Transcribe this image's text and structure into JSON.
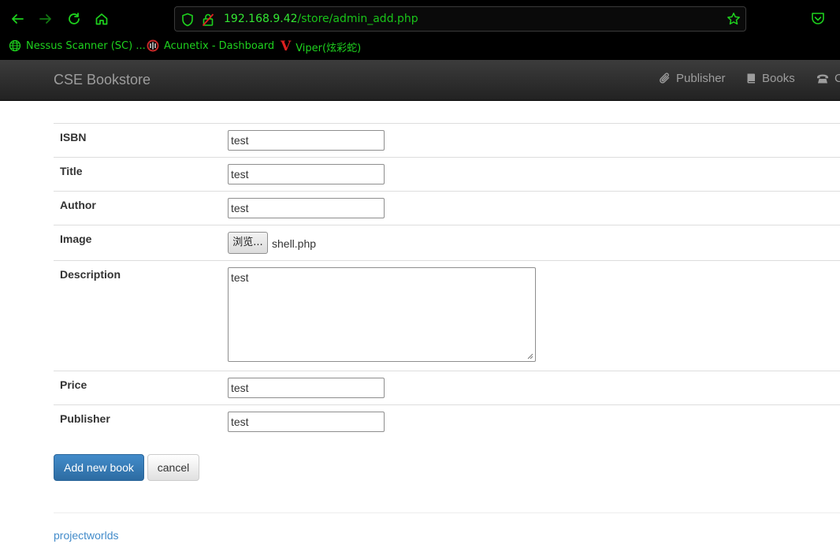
{
  "browser": {
    "url_host": "192.168.9.42",
    "url_path": "/store/admin_add.php",
    "bookmarks": [
      {
        "label": "Nessus Scanner (SC) ..."
      },
      {
        "label": "Acunetix - Dashboard"
      },
      {
        "label": "Viper(炫彩蛇)"
      }
    ],
    "accent_color": "#1ed21e"
  },
  "navbar": {
    "brand": "CSE Bookstore",
    "links": [
      {
        "label": "Publisher",
        "icon": "paperclip-icon"
      },
      {
        "label": "Books",
        "icon": "book-icon"
      },
      {
        "label": "C",
        "icon": "phone-icon"
      }
    ]
  },
  "form": {
    "isbn": {
      "label": "ISBN",
      "value": "test"
    },
    "title": {
      "label": "Title",
      "value": "test"
    },
    "author": {
      "label": "Author",
      "value": "test"
    },
    "image": {
      "label": "Image",
      "button": "浏览...",
      "filename": "shell.php"
    },
    "description": {
      "label": "Description",
      "value": "test"
    },
    "price": {
      "label": "Price",
      "value": "test"
    },
    "publisher": {
      "label": "Publisher",
      "value": "test"
    },
    "submit_label": "Add new book",
    "cancel_label": "cancel"
  },
  "footer": {
    "link": "projectworlds"
  }
}
